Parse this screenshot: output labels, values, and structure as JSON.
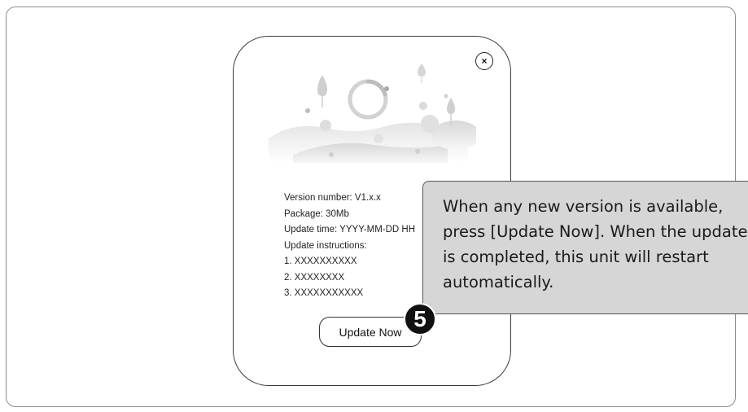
{
  "dialog": {
    "close_icon": "close-icon",
    "info": {
      "version": "Version number: V1.x.x",
      "package": "Package: 30Mb",
      "update_time": "Update time: YYYY-MM-DD HH",
      "instructions_label": "Update instructions:",
      "instructions": [
        "1. XXXXXXXXXX",
        "2. XXXXXXXX",
        "3. XXXXXXXXXXX"
      ]
    },
    "update_button_label": "Update Now"
  },
  "callout": {
    "step_number": "5",
    "text": "When any new version is available, press [Update Now]. When the update is completed, this unit will restart automatically."
  }
}
